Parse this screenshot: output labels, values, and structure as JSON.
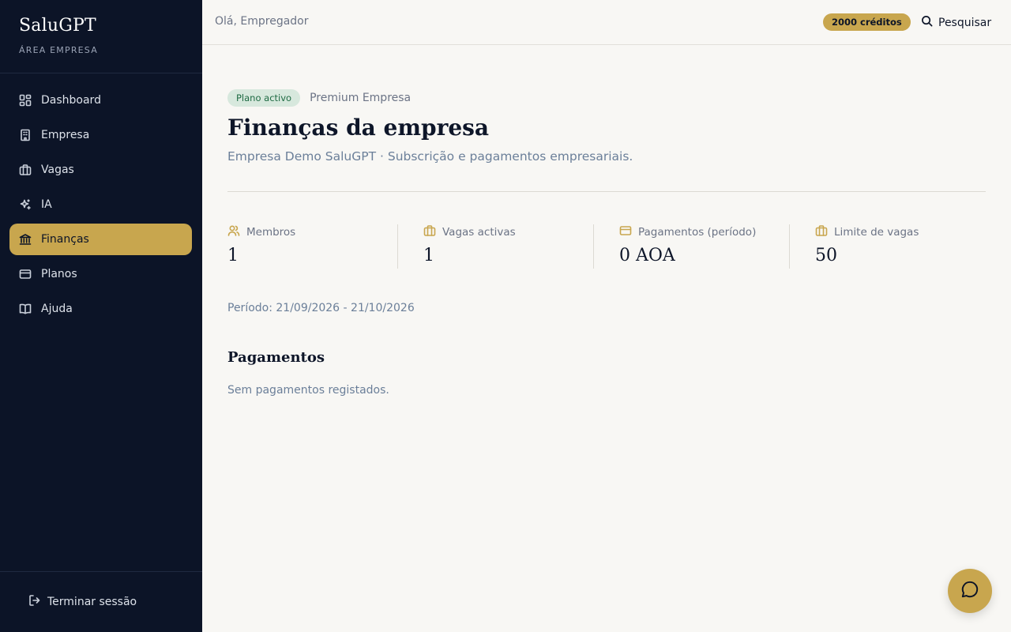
{
  "brand": {
    "name": "SaluGPT",
    "subtitle": "ÁREA EMPRESA"
  },
  "sidebar": {
    "items": [
      {
        "label": "Dashboard",
        "icon": "dashboard-icon",
        "active": false
      },
      {
        "label": "Empresa",
        "icon": "building-icon",
        "active": false
      },
      {
        "label": "Vagas",
        "icon": "briefcase-icon",
        "active": false
      },
      {
        "label": "IA",
        "icon": "sparkles-icon",
        "active": false
      },
      {
        "label": "Finanças",
        "icon": "bank-icon",
        "active": true
      },
      {
        "label": "Planos",
        "icon": "credit-card-icon",
        "active": false
      },
      {
        "label": "Ajuda",
        "icon": "book-icon",
        "active": false
      }
    ],
    "logout_label": "Terminar sessão"
  },
  "header": {
    "greeting": "Olá, Empregador",
    "credits": "2000 créditos",
    "search_label": "Pesquisar"
  },
  "main": {
    "plan_badge": "Plano activo",
    "plan_name": "Premium Empresa",
    "title": "Finanças da empresa",
    "subtitle": "Empresa Demo SaluGPT · Subscrição e pagamentos empresariais.",
    "stats": [
      {
        "label": "Membros",
        "value": "1",
        "icon": "users-icon"
      },
      {
        "label": "Vagas activas",
        "value": "1",
        "icon": "briefcase-icon"
      },
      {
        "label": "Pagamentos (período)",
        "value": "0 AOA",
        "icon": "credit-card-icon"
      },
      {
        "label": "Limite de vagas",
        "value": "50",
        "icon": "briefcase-icon"
      }
    ],
    "period": "Período: 21/09/2026 - 21/10/2026",
    "payments_title": "Pagamentos",
    "payments_empty": "Sem pagamentos registados."
  },
  "colors": {
    "sidebar_bg": "#0c1427",
    "accent": "#c8a64e",
    "page_bg": "#f8f7f4",
    "badge_bg": "#d7e8dd",
    "badge_text": "#1e6a43"
  }
}
